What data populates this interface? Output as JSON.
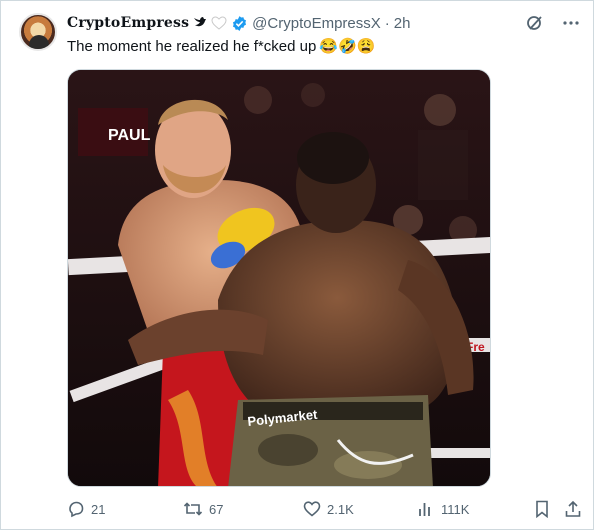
{
  "tweet": {
    "display_name": "CryptoEmpress",
    "badge_emoji": "🐦",
    "handle": "@CryptoEmpressX",
    "separator": "·",
    "time": "2h",
    "text": "The moment he realized he f*cked up",
    "emojis": "😂🤣😩",
    "media_labels": {
      "banner": "PAUL",
      "shorts": "Polymarket",
      "ring_logo": "Fre"
    }
  },
  "actions": {
    "replies": "21",
    "retweets": "67",
    "likes": "2.1K",
    "views": "111K"
  },
  "icons": {
    "grok": "grok-icon",
    "more": "more-icon",
    "reply": "reply-icon",
    "retweet": "retweet-icon",
    "like": "like-icon",
    "views": "views-icon",
    "bookmark": "bookmark-icon",
    "share": "share-icon"
  },
  "colors": {
    "verified": "#1d9bf0",
    "secondary_text": "#536471",
    "border": "#cfd9de"
  }
}
